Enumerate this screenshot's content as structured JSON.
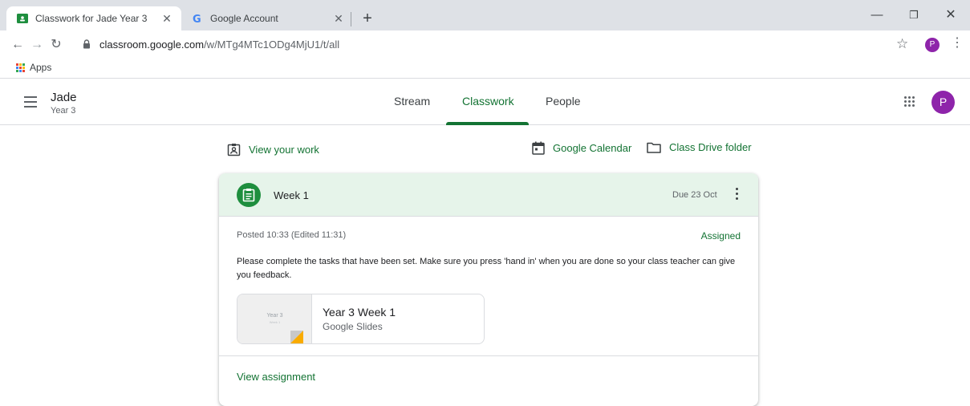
{
  "browser": {
    "tabs": [
      {
        "title": "Classwork for Jade Year 3",
        "icon": "google-classroom-icon",
        "active": true
      },
      {
        "title": "Google Account",
        "icon": "google-g-icon",
        "active": false
      }
    ],
    "new_tab_label": "+",
    "url_host": "classroom.google.com",
    "url_path": "/w/MTg4MTc1ODg4MjU1/t/all",
    "profile_initial": "P",
    "bookmarks": [
      {
        "label": "Apps",
        "icon": "apps-grid-icon"
      }
    ]
  },
  "header": {
    "class_name": "Jade",
    "class_section": "Year 3",
    "nav_tabs": [
      "Stream",
      "Classwork",
      "People"
    ],
    "active_tab": "Classwork",
    "avatar_initial": "P"
  },
  "links": {
    "view_work": "View your work",
    "calendar": "Google Calendar",
    "drive_folder": "Class Drive folder"
  },
  "assignment": {
    "title": "Week 1",
    "due": "Due 23 Oct",
    "posted": "Posted 10:33 (Edited 11:31)",
    "status": "Assigned",
    "instructions": "Please complete the tasks that have been set. Make sure you press 'hand in' when you are done so your class teacher can give you feedback.",
    "attachment": {
      "thumb_title": "Year 3",
      "thumb_subtitle": "Week 1",
      "title": "Year 3 Week 1",
      "type": "Google Slides"
    },
    "view_link": "View assignment"
  },
  "colors": {
    "accent_green": "#137333",
    "card_header_bg": "#e6f4ea",
    "avatar_purple": "#8e24aa",
    "slides_yellow": "#f9ab00"
  }
}
